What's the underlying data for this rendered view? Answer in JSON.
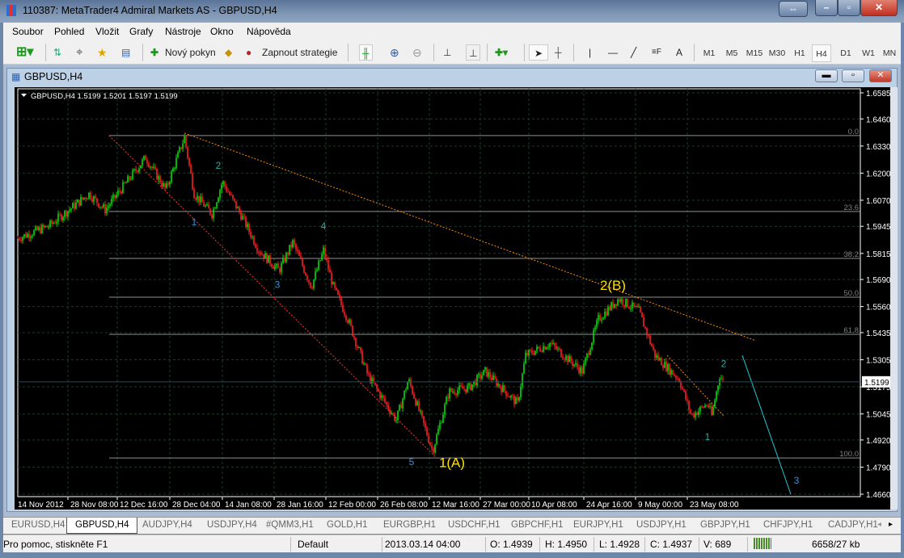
{
  "window": {
    "title": "110387: MetaTrader4 Admiral Markets AS - GBPUSD,H4"
  },
  "menu": [
    "Soubor",
    "Pohled",
    "Vložit",
    "Grafy",
    "Nástroje",
    "Okno",
    "Nápověda"
  ],
  "toolbar": {
    "new_order": "Nový pokyn",
    "autotrading": "Zapnout strategie",
    "text_tool": "A",
    "timeframes": [
      "M1",
      "M5",
      "M15",
      "M30",
      "H1",
      "H4",
      "D1",
      "W1",
      "MN"
    ],
    "active_timeframe": "H4"
  },
  "chart_window": {
    "title": "GBPUSD,H4"
  },
  "chart_data": {
    "type": "candlestick",
    "header": "GBPUSD,H4  1.5199 1.5201 1.5197 1.5199",
    "current_price": "1.5199",
    "ylim": [
      1.466,
      1.6585
    ],
    "y_ticks": [
      "1.6585",
      "1.6460",
      "1.6330",
      "1.6200",
      "1.6070",
      "1.5945",
      "1.5815",
      "1.5690",
      "1.5560",
      "1.5435",
      "1.5305",
      "1.5175",
      "1.5045",
      "1.4920",
      "1.4790",
      "1.4660"
    ],
    "x_ticks": [
      "14 Nov 2012",
      "28 Nov 08:00",
      "12 Dec 16:00",
      "28 Dec 04:00",
      "14 Jan 08:00",
      "28 Jan 16:00",
      "12 Feb 00:00",
      "26 Feb 08:00",
      "12 Mar 16:00",
      "27 Mar 00:00",
      "10 Apr 08:00",
      "24 Apr 16:00",
      "9 May 00:00",
      "23 May 08:00"
    ],
    "bar_range": [
      0,
      1042
    ],
    "price_path": [
      [
        0,
        1.5888
      ],
      [
        38,
        1.5946
      ],
      [
        88,
        1.6101
      ],
      [
        108,
        1.6024
      ],
      [
        158,
        1.6275
      ],
      [
        183,
        1.612
      ],
      [
        206,
        1.6372
      ],
      [
        218,
        1.6101
      ],
      [
        240,
        1.6004
      ],
      [
        253,
        1.6159
      ],
      [
        278,
        1.5985
      ],
      [
        298,
        1.583
      ],
      [
        323,
        1.5733
      ],
      [
        340,
        1.5868
      ],
      [
        363,
        1.5655
      ],
      [
        378,
        1.583
      ],
      [
        390,
        1.5655
      ],
      [
        408,
        1.55
      ],
      [
        433,
        1.5229
      ],
      [
        468,
        1.5016
      ],
      [
        483,
        1.521
      ],
      [
        513,
        1.4868
      ],
      [
        533,
        1.5152
      ],
      [
        558,
        1.5171
      ],
      [
        578,
        1.5249
      ],
      [
        618,
        1.5094
      ],
      [
        628,
        1.5326
      ],
      [
        658,
        1.5384
      ],
      [
        698,
        1.5249
      ],
      [
        718,
        1.55
      ],
      [
        743,
        1.5597
      ],
      [
        768,
        1.5539
      ],
      [
        788,
        1.5326
      ],
      [
        818,
        1.521
      ],
      [
        833,
        1.5036
      ],
      [
        853,
        1.5094
      ],
      [
        858,
        1.5036
      ],
      [
        868,
        1.5229
      ],
      [
        873,
        1.5199
      ]
    ],
    "fibonacci": [
      {
        "label": "0.0",
        "price": 1.638
      },
      {
        "label": "23.6",
        "price": 1.6016
      },
      {
        "label": "38.2",
        "price": 1.5791
      },
      {
        "label": "50.0",
        "price": 1.5605
      },
      {
        "label": "61.8",
        "price": 1.5427
      },
      {
        "label": "100.0",
        "price": 1.4834
      }
    ],
    "trendlines": [
      {
        "color": "#ff8c00",
        "from": [
          206,
          1.6392
        ],
        "to": [
          913,
          1.5396
        ]
      },
      {
        "color": "#ff3030",
        "from": [
          113,
          1.638
        ],
        "to": [
          518,
          1.4834
        ]
      },
      {
        "color": "#ff8c00",
        "from": [
          803,
          1.5326
        ],
        "to": [
          873,
          1.5036
        ]
      },
      {
        "color": "#20c8d8",
        "from": [
          896,
          1.5326
        ],
        "to": [
          956,
          1.466
        ]
      }
    ],
    "wave_labels": [
      {
        "text": "1",
        "bar": 218,
        "price": 1.595,
        "color": "#3a8fd0"
      },
      {
        "text": "2",
        "bar": 248,
        "price": 1.622,
        "color": "#20b0a8"
      },
      {
        "text": "3",
        "bar": 321,
        "price": 1.565,
        "color": "#3a8fd0"
      },
      {
        "text": "4",
        "bar": 378,
        "price": 1.593,
        "color": "#20b0a8"
      },
      {
        "text": "5",
        "bar": 487,
        "price": 1.48,
        "color": "#3a8fd0"
      },
      {
        "text": "1(A)",
        "bar": 537,
        "price": 1.479,
        "color": "#ffe000"
      },
      {
        "text": "2(B)",
        "bar": 736,
        "price": 1.564,
        "color": "#ffe000"
      },
      {
        "text": "1",
        "bar": 853,
        "price": 1.492,
        "color": "#20b0a8"
      },
      {
        "text": "2",
        "bar": 873,
        "price": 1.527,
        "color": "#20b0a8"
      },
      {
        "text": "3",
        "bar": 963,
        "price": 1.471,
        "color": "#3a8fd0"
      }
    ]
  },
  "tabs": [
    "EURUSD,H4",
    "GBPUSD,H4",
    "AUDJPY,H4",
    "USDJPY,H4",
    "#QMM3,H1",
    "GOLD,H1",
    "EURGBP,H1",
    "USDCHF,H1",
    "GBPCHF,H1",
    "EURJPY,H1",
    "USDJPY,H1",
    "GBPJPY,H1",
    "CHFJPY,H1",
    "CADJPY,H1"
  ],
  "status": {
    "help": "Pro pomoc, stiskněte F1",
    "profile": "Default",
    "time": "2013.03.14 04:00",
    "open": "O: 1.4939",
    "high": "H: 1.4950",
    "low": "L: 1.4928",
    "close": "C: 1.4937",
    "volume": "V: 689",
    "traffic": "6658/27 kb"
  }
}
